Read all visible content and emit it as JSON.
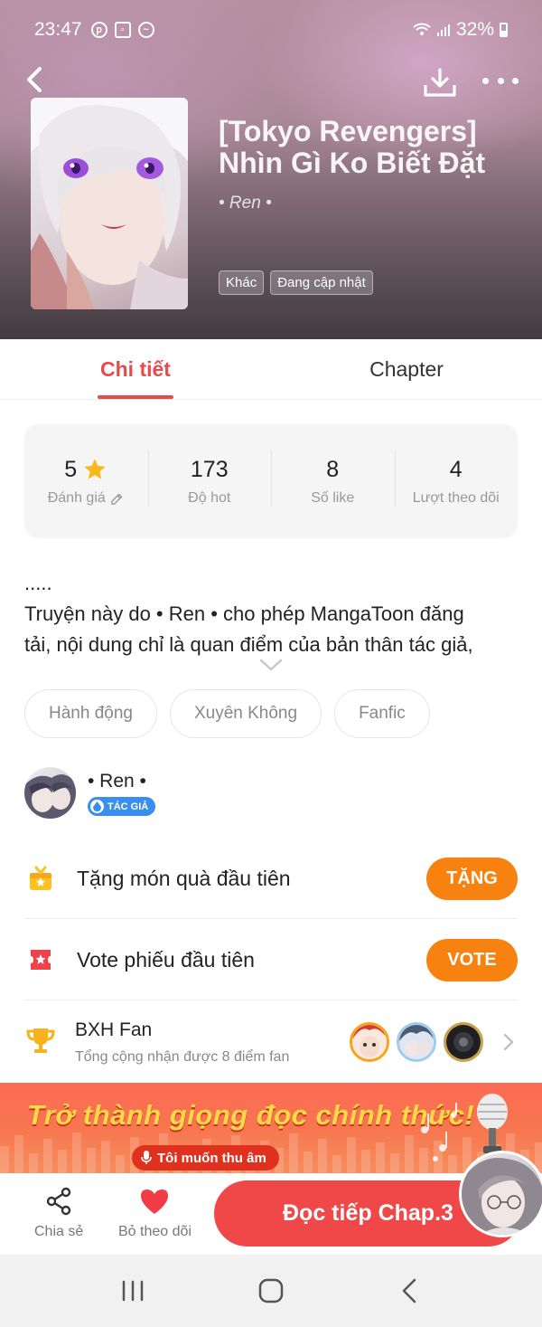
{
  "status_bar": {
    "time": "23:47",
    "battery": "32%"
  },
  "book": {
    "title": "[Tokyo Revengers] Nhìn Gì Ko Biết Đặt",
    "author": "• Ren •",
    "tags": [
      "Khác",
      "Đang cập nhật"
    ]
  },
  "tabs": [
    {
      "label": "Chi tiết",
      "active": true
    },
    {
      "label": "Chapter",
      "active": false
    }
  ],
  "stats": [
    {
      "value": "5",
      "label": "Đánh giá"
    },
    {
      "value": "173",
      "label": "Độ hot"
    },
    {
      "value": "8",
      "label": "Số like"
    },
    {
      "value": "4",
      "label": "Lượt theo dõi"
    }
  ],
  "description": {
    "line1": ".....",
    "line2": "Truyện này do • Ren • cho phép MangaToon đăng",
    "line3": "tải, nội dung chỉ là quan điểm của bản thân tác giả,"
  },
  "genres": [
    "Hành động",
    "Xuyên Không",
    "Fanfic"
  ],
  "author_section": {
    "name": "• Ren •",
    "badge": "TÁC GIẢ"
  },
  "gift_row": {
    "label": "Tặng món quà đầu tiên",
    "button": "TẶNG"
  },
  "vote_row": {
    "label": "Vote phiếu đầu tiên",
    "button": "VOTE"
  },
  "fan_rank": {
    "title": "BXH Fan",
    "subtitle": "Tổng cộng nhận được 8 điểm fan"
  },
  "banner": {
    "headline": "Trở thành giọng đọc chính thức!",
    "button": "Tôi muốn thu âm"
  },
  "bottom_bar": {
    "share": "Chia sẻ",
    "unfollow": "Bỏ theo dõi",
    "read": "Đọc tiếp Chap.3"
  },
  "colors": {
    "accent": "#e84a4a",
    "orange": "#f7820f",
    "read_button": "#f04848"
  }
}
